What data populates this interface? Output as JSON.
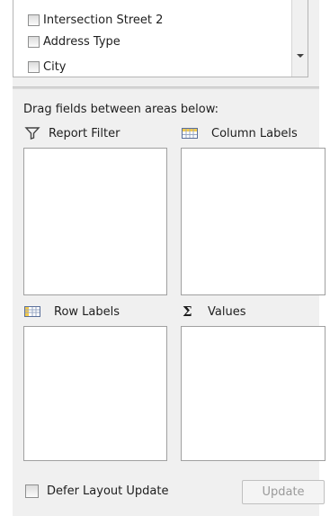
{
  "field_list": {
    "items": [
      {
        "label": "Intersection Street 2",
        "checked": false
      },
      {
        "label": "Address Type",
        "checked": false
      },
      {
        "label": "City",
        "checked": false
      }
    ]
  },
  "instructions": "Drag fields between areas below:",
  "areas": {
    "report_filter": {
      "label": "Report Filter",
      "icon": "filter-icon"
    },
    "column_labels": {
      "label": "Column Labels",
      "icon": "column-labels-icon"
    },
    "row_labels": {
      "label": "Row Labels",
      "icon": "row-labels-icon"
    },
    "values": {
      "label": "Values",
      "icon": "sigma-icon"
    }
  },
  "footer": {
    "defer_label": "Defer Layout Update",
    "defer_checked": false,
    "update_label": "Update"
  },
  "colors": {
    "panel_bg": "#f0f0f0",
    "box_border": "#a0a0a0",
    "disabled_text": "#9a9a9a"
  }
}
